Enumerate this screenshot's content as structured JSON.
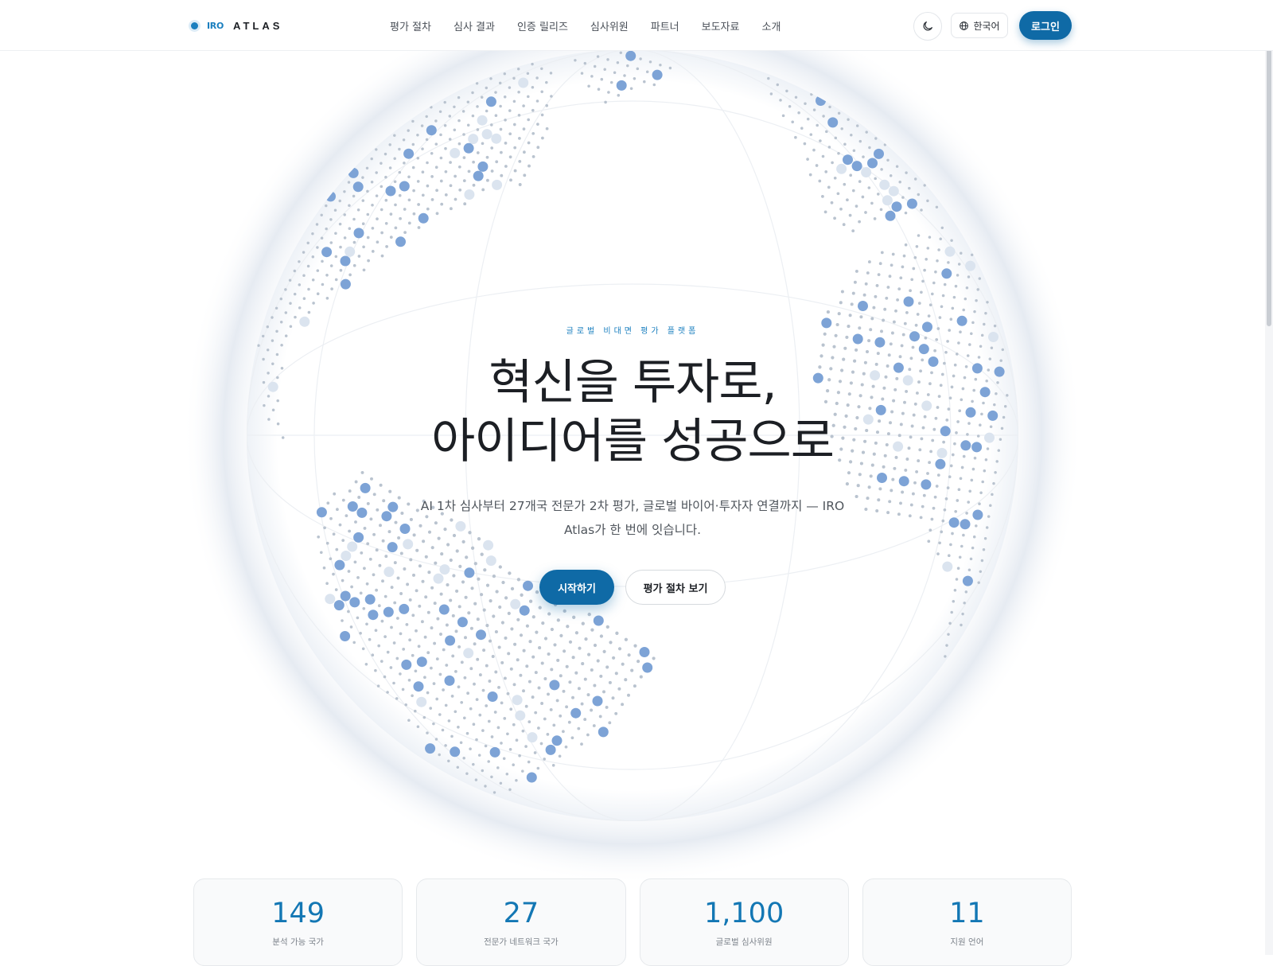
{
  "header": {
    "logo": {
      "iro": "IRO",
      "atlas": "ATLAS"
    },
    "nav": [
      "평가 절차",
      "심사 결과",
      "인증 릴리즈",
      "심사위원",
      "파트너",
      "보도자료",
      "소개"
    ],
    "theme_icon": "moon-icon",
    "language": {
      "icon": "globe-icon",
      "label": "한국어"
    },
    "login_label": "로그인"
  },
  "hero": {
    "eyebrow": "글로벌 비대면 평가 플랫폼",
    "title_line1": "혁신을 투자로,",
    "title_line2": "아이디어를 성공으로",
    "subtitle": "AI 1차 심사부터 27개국 전문가 2차 평가, 글로벌 바이어·투자자 연결까지 — IRO Atlas가 한 번에 잇습니다.",
    "cta_primary": "시작하기",
    "cta_secondary": "평가 절차 보기"
  },
  "stats": [
    {
      "value": "149",
      "label": "분석 가능 국가"
    },
    {
      "value": "27",
      "label": "전문가 네트워크 국가"
    },
    {
      "value": "1,100",
      "label": "글로벌 심사위원"
    },
    {
      "value": "11",
      "label": "지원 언어"
    }
  ],
  "colors": {
    "accent": "#0f6aa6",
    "accent_text": "#1a7fbf",
    "stat_value": "#1377b4",
    "dot_dark": "#7da3d6",
    "dot_light": "#dbe4ef"
  }
}
